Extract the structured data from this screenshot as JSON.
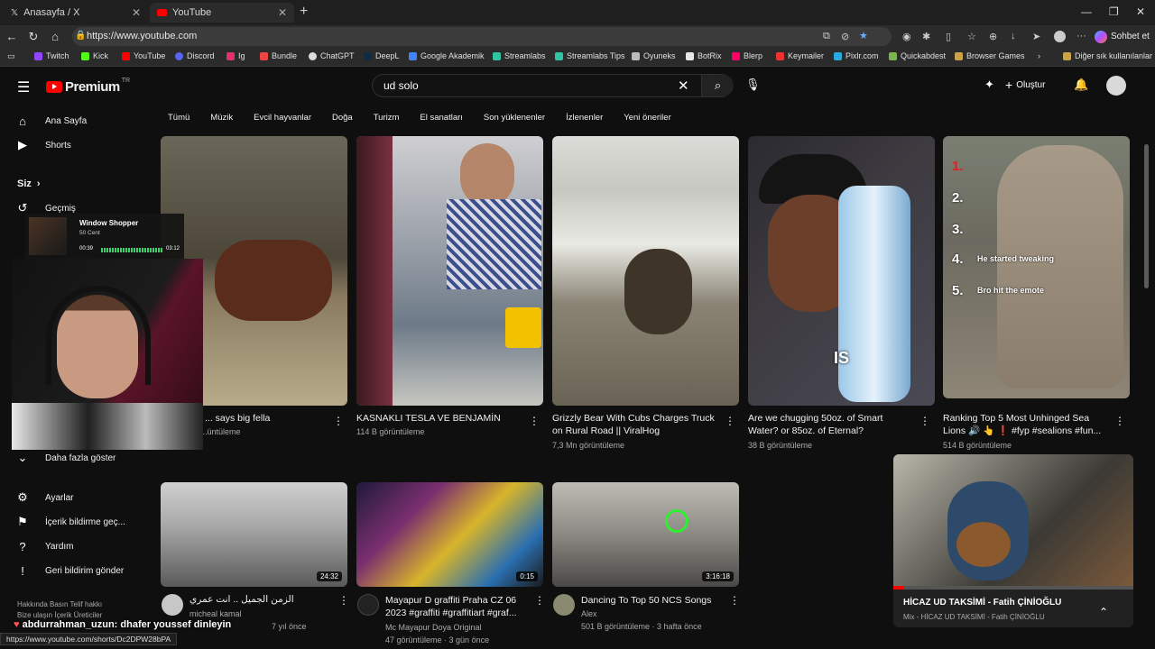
{
  "browser": {
    "tabs": [
      {
        "title": "Anasayfa / X",
        "icon": "x-logo-icon"
      },
      {
        "title": "YouTube",
        "icon": "youtube-icon"
      }
    ],
    "url": "https://www.youtube.com",
    "chat_label": "Sohbet et",
    "bookmarks": [
      "Twitch",
      "Kick",
      "YouTube",
      "Discord",
      "Ig",
      "Bundle",
      "ChatGPT",
      "DeepL",
      "Google Akademik",
      "Streamlabs",
      "Streamlabs Tips",
      "Oyuneks",
      "BotRix",
      "Blerp",
      "Keymailer",
      "Pixlr.com",
      "Quickabdest",
      "Browser Games"
    ],
    "other_bookmarks": "Diğer sık kullanılanlar",
    "status_url": "https://www.youtube.com/shorts/Dc2DPW28bPA"
  },
  "youtube": {
    "logo": "Premium",
    "region": "TR",
    "search_value": "ud solo",
    "create_label": "Oluştur"
  },
  "sidebar": {
    "home": "Ana Sayfa",
    "shorts": "Shorts",
    "you": "Siz",
    "history": "Geçmiş",
    "show_more": "Daha fazla göster",
    "settings": "Ayarlar",
    "report": "İçerik bildirme geç...",
    "help": "Yardım",
    "feedback": "Geri bildirim gönder",
    "footer1": "Hakkında   Basın   Telif hakkı",
    "footer2": "Bize ulaşın   İçerik Üreticiler"
  },
  "chips": [
    "Tümü",
    "Müzik",
    "Evcil hayvanlar",
    "Doğa",
    "Turizm",
    "El sanatları",
    "Son yüklenenler",
    "İzlenenler",
    "Yeni öneriler"
  ],
  "videos_row1": [
    {
      "title": "... says big fella",
      "meta": "...üntüleme"
    },
    {
      "title": "KASNAKLI TESLA VE BENJAMİN",
      "meta": "114 B görüntüleme"
    },
    {
      "title": "Grizzly Bear With Cubs Charges Truck",
      "title2": "on Rural Road || ViralHog",
      "meta": "7,3 Mn görüntüleme"
    },
    {
      "title": "Are we chugging 50oz. of Smart",
      "title2": "Water? or 85oz. of Eternal?",
      "meta": "38 B görüntüleme"
    },
    {
      "title": "Ranking Top 5 Most Unhinged Sea",
      "title2": "Lions 🔊 👆 ❗ #fyp #sealions #fun...",
      "meta": "514 B görüntüleme"
    }
  ],
  "sealion_overlay": [
    "1.",
    "2.",
    "3.",
    "4.",
    "He started tweaking",
    "5.",
    "Bro hit the emote"
  ],
  "smartwater_overlay": "IS",
  "videos_row2": [
    {
      "title": "الزمن الجميل .. انت عمري",
      "channel": "micheal kamal",
      "meta": "7 yıl önce",
      "duration": "24:32"
    },
    {
      "title": "Mayapur D graffiti Praha CZ 06",
      "title2": "2023 #graffiti #graffitiart #graf...",
      "channel": "Mc Mayapur Doya Original",
      "meta": "47 görüntüleme · 3 gün önce",
      "duration": "0:15"
    },
    {
      "title": "Dancing To Top 50 NCS Songs",
      "channel": "Alex",
      "meta": "501 B görüntüleme · 3 hafta önce",
      "duration": "3:16:18"
    }
  ],
  "miniplayer": {
    "title": "HİCAZ UD TAKSİMİ - Fatih ÇİNİOĞLU",
    "sub": "Mix - HİCAZ UD TAKSİMİ - Fatih ÇİNİOĞLU"
  },
  "stream": {
    "song": "Window Shopper",
    "artist": "50 Cent",
    "elapsed": "00:39",
    "total": "03:12",
    "chat_user": "abdurrahman_uzun",
    "chat_text": ": dhafer youssef dinleyin"
  }
}
